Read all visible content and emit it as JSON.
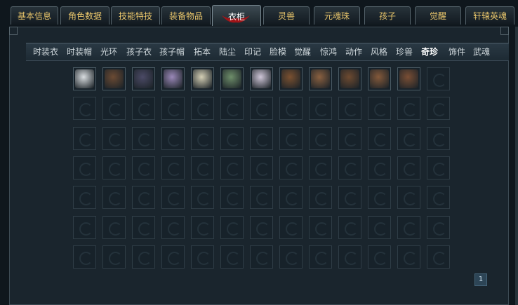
{
  "tabs": [
    {
      "label": "基本信息"
    },
    {
      "label": "角色数据"
    },
    {
      "label": "技能特技"
    },
    {
      "label": "装备物品"
    },
    {
      "label": "衣柜",
      "active": true
    },
    {
      "label": "灵兽"
    },
    {
      "label": "元魂珠"
    },
    {
      "label": "孩子"
    },
    {
      "label": "觉醒"
    },
    {
      "label": "轩辕英魂"
    }
  ],
  "subnav": {
    "items": [
      {
        "label": "时装衣"
      },
      {
        "label": "时装帽"
      },
      {
        "label": "光环"
      },
      {
        "label": "孩子衣"
      },
      {
        "label": "孩子帽"
      },
      {
        "label": "拓本"
      },
      {
        "label": "陆尘"
      },
      {
        "label": "印记"
      },
      {
        "label": "脸模"
      },
      {
        "label": "觉醒"
      },
      {
        "label": "惊鸿"
      },
      {
        "label": "动作"
      },
      {
        "label": "风格"
      },
      {
        "label": "珍兽"
      },
      {
        "label": "奇珍",
        "active": true
      },
      {
        "label": "饰件"
      },
      {
        "label": "武魂"
      }
    ]
  },
  "grid": {
    "rows": 7,
    "cols": 13,
    "items": [
      {
        "icon": "white-horse-icon",
        "color": "#d9dde0"
      },
      {
        "icon": "brown-beast-icon",
        "color": "#6b4a33"
      },
      {
        "icon": "dark-mount-icon",
        "color": "#4b4a66"
      },
      {
        "icon": "purple-wing-icon",
        "color": "#9a88b8"
      },
      {
        "icon": "pale-cape-icon",
        "color": "#d4cfb5"
      },
      {
        "icon": "jade-ring-icon",
        "color": "#6e8e6a"
      },
      {
        "icon": "spear-icon",
        "color": "#cfc6d8"
      },
      {
        "icon": "saddle-icon",
        "color": "#7a5030"
      },
      {
        "icon": "saddle-icon",
        "color": "#8a6040"
      },
      {
        "icon": "saddle-icon",
        "color": "#6e4a30"
      },
      {
        "icon": "saddle-icon",
        "color": "#84593a"
      },
      {
        "icon": "chest-icon",
        "color": "#7a4e34"
      }
    ]
  },
  "pager": {
    "page": "1"
  }
}
